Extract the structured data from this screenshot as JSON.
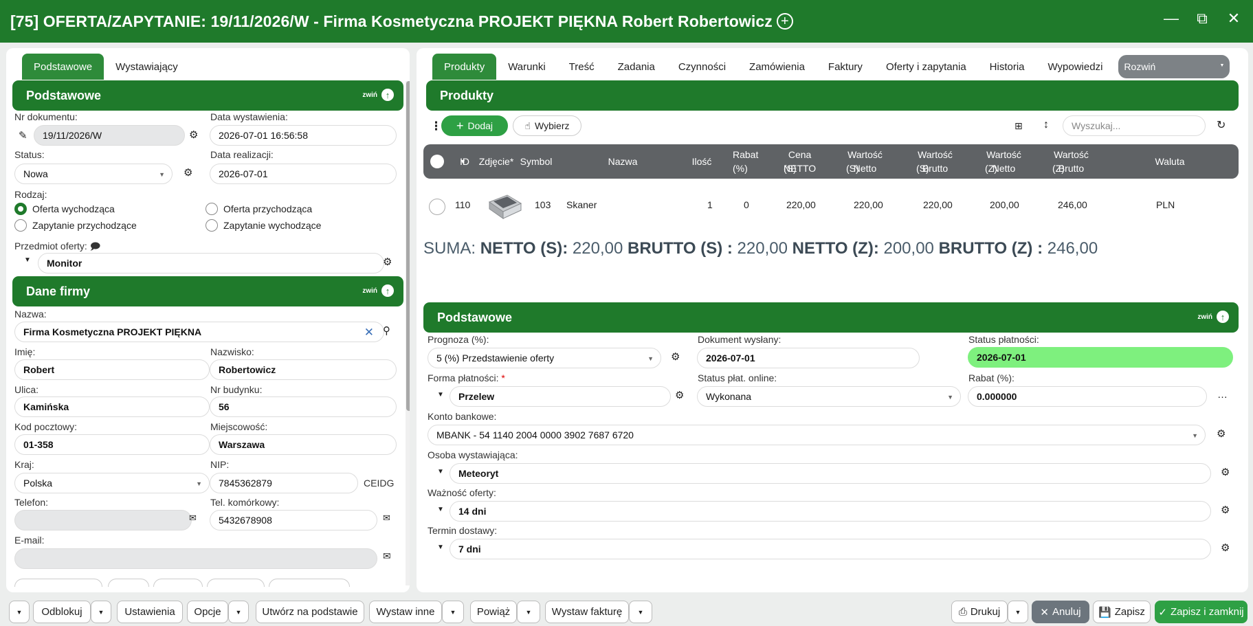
{
  "window": {
    "title": "[75] OFERTA/ZAPYTANIE: 19/11/2026/W - Firma Kosmetyczna PROJEKT PIĘKNA Robert Robertowicz"
  },
  "left": {
    "tabs": [
      "Podstawowe",
      "Wystawiający"
    ],
    "section1": {
      "title": "Podstawowe",
      "collapse": "zwiń"
    },
    "nr_label": "Nr dokumentu:",
    "nr_value": "19/11/2026/W",
    "data_wyst_label": "Data wystawienia:",
    "data_wyst_value": "2026-07-01 16:56:58",
    "status_label": "Status:",
    "status_value": "Nowa",
    "data_real_label": "Data realizacji:",
    "data_real_value": "2026-07-01",
    "rodzaj_label": "Rodzaj:",
    "radios": [
      {
        "label": "Oferta wychodząca",
        "checked": true
      },
      {
        "label": "Oferta przychodząca",
        "checked": false
      },
      {
        "label": "Zapytanie przychodzące",
        "checked": false
      },
      {
        "label": "Zapytanie wychodzące",
        "checked": false
      }
    ],
    "przedmiot_label": "Przedmiot oferty:",
    "przedmiot_value": "Monitor",
    "section2": {
      "title": "Dane firmy",
      "collapse": "zwiń"
    },
    "nazwa_label": "Nazwa:",
    "nazwa_value": "Firma Kosmetyczna PROJEKT PIĘKNA",
    "imie_label": "Imię:",
    "imie_value": "Robert",
    "nazwisko_label": "Nazwisko:",
    "nazwisko_value": "Robertowicz",
    "ulica_label": "Ulica:",
    "ulica_value": "Kamińska",
    "nr_bud_label": "Nr budynku:",
    "nr_bud_value": "56",
    "kod_label": "Kod pocztowy:",
    "kod_value": "01-358",
    "miejsc_label": "Miejscowość:",
    "miejsc_value": "Warszawa",
    "kraj_label": "Kraj:",
    "kraj_value": "Polska",
    "nip_label": "NIP:",
    "nip_value": "7845362879",
    "ceidg": "CEIDG",
    "tel_label": "Telefon:",
    "tel_value": "",
    "kom_label": "Tel. komórkowy:",
    "kom_value": "5432678908",
    "email_label": "E-mail:",
    "email_value": ""
  },
  "right": {
    "tabs": [
      "Produkty",
      "Warunki",
      "Treść",
      "Zadania",
      "Czynności",
      "Zamówienia",
      "Faktury",
      "Oferty i zapytania",
      "Historia",
      "Wypowiedzi"
    ],
    "expand_select": "Rozwiń",
    "section": {
      "title": "Produkty"
    },
    "toolbar": {
      "add": "Dodaj",
      "choose": "Wybierz",
      "search_placeholder": "Wyszukaj..."
    },
    "table": {
      "headers": [
        {
          "l1": "ID",
          "l2": ""
        },
        {
          "l1": "Zdjęcie*",
          "l2": ""
        },
        {
          "l1": "Symbol",
          "l2": ""
        },
        {
          "l1": "Nazwa",
          "l2": ""
        },
        {
          "l1": "Ilość",
          "l2": ""
        },
        {
          "l1": "Rabat",
          "l2": "(%)"
        },
        {
          "l1": "Cena NETTO",
          "l2": "(S)"
        },
        {
          "l1": "Wartość Netto",
          "l2": "(S)"
        },
        {
          "l1": "Wartość Brutto",
          "l2": "(S)"
        },
        {
          "l1": "Wartość Netto",
          "l2": "(Z)"
        },
        {
          "l1": "Wartość Brutto",
          "l2": "(Z)"
        },
        {
          "l1": "Waluta",
          "l2": ""
        }
      ],
      "rows": [
        {
          "id": "110",
          "symbol": "103",
          "nazwa": "Skaner",
          "ilosc": "1",
          "rabat": "0",
          "cena_netto_s": "220,00",
          "wart_netto_s": "220,00",
          "wart_brutto_s": "220,00",
          "wart_netto_z": "200,00",
          "wart_brutto_z": "246,00",
          "waluta": "PLN"
        }
      ]
    },
    "suma": {
      "prefix": "SUMA:",
      "netto_s_label": "NETTO (S):",
      "netto_s": "220,00",
      "brutto_s_label": "BRUTTO (S) :",
      "brutto_s": "220,00",
      "netto_z_label": "NETTO (Z):",
      "netto_z": "200,00",
      "brutto_z_label": "BRUTTO (Z) :",
      "brutto_z": "246,00"
    },
    "section2": {
      "title": "Podstawowe",
      "collapse": "zwiń"
    },
    "prognoza_label": "Prognoza (%):",
    "prognoza_value": "5 (%) Przedstawienie oferty",
    "dok_label": "Dokument wysłany:",
    "dok_value": "2026-07-01",
    "status_pl_label": "Status płatności:",
    "status_pl_value": "2026-07-01",
    "forma_label": "Forma płatności:",
    "forma_value": "Przelew",
    "online_label": "Status płat. online:",
    "online_value": "Wykonana",
    "rabat_label": "Rabat (%):",
    "rabat_value": "0.000000",
    "konto_label": "Konto bankowe:",
    "konto_value": "MBANK - 54 1140 2004 0000 3902 7687 6720",
    "osoba_label": "Osoba wystawiająca:",
    "osoba_value": "Meteoryt",
    "waznosc_label": "Ważność oferty:",
    "waznosc_value": "14 dni",
    "termin_label": "Termin dostawy:",
    "termin_value": "7 dni"
  },
  "bottom": {
    "odblokuj": "Odblokuj",
    "ustawienia": "Ustawienia",
    "opcje": "Opcje",
    "utworz": "Utwórz na podstawie",
    "wystaw_inne": "Wystaw inne",
    "powiaz": "Powiąż",
    "wystaw_fakture": "Wystaw fakturę",
    "drukuj": "Drukuj",
    "anuluj": "Anuluj",
    "zapisz": "Zapisz",
    "zapisz_zamknij": "Zapisz i zamknij"
  },
  "colors": {
    "green_dark": "#1f7a2b",
    "green_accent": "#2ea044",
    "status_highlight": "#7ef07e"
  }
}
